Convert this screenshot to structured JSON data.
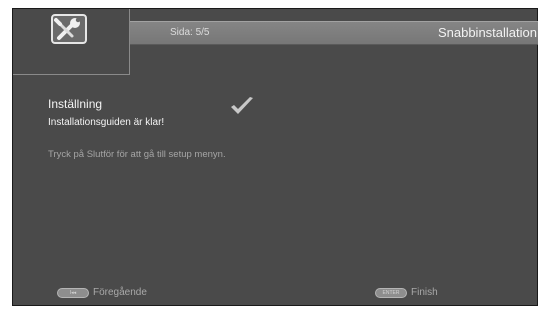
{
  "header": {
    "page_indicator": "Sida:  5/5",
    "title": "Snabbinstallation"
  },
  "header_icon": {
    "name": "wrench-icon"
  },
  "content": {
    "heading": "Inställning",
    "subtitle": "Installationsguiden är klar!",
    "instruction": "Tryck på Slutför för att gå till setup menyn.",
    "status_icon": "checkmark-icon"
  },
  "footer": {
    "previous": {
      "key_label": "I◂◂",
      "label": "Föregående"
    },
    "finish": {
      "key_label": "ENTER",
      "label": "Finish"
    }
  }
}
